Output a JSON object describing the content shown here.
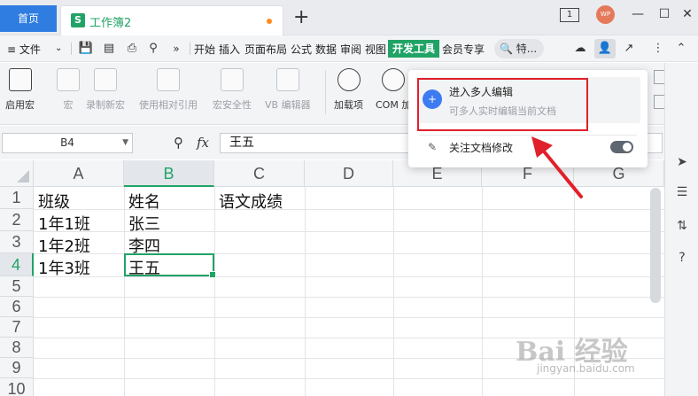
{
  "tabbar": {
    "home_label": "首页",
    "doc_icon": "S",
    "doc_title": "工作簿2",
    "add_label": "+",
    "page_icon_label": "1",
    "avatar_label": "WP"
  },
  "menubar": {
    "file_label": "≡ 文件",
    "items": [
      "开始",
      "插入",
      "页面布局",
      "公式",
      "数据",
      "审阅",
      "视图"
    ],
    "active_label": "开发工具",
    "member_label": "会员专享",
    "search_label": "查找",
    "search_short": "特..."
  },
  "ribbon": {
    "buttons": [
      {
        "label": "启用宏",
        "enabled": true
      },
      {
        "label": "宏",
        "enabled": false
      },
      {
        "label": "录制新宏",
        "enabled": false
      },
      {
        "label": "使用相对引用",
        "enabled": false
      },
      {
        "label": "宏安全性",
        "enabled": false
      },
      {
        "label": "VB 编辑器",
        "enabled": false
      },
      {
        "label": "加载项",
        "enabled": true
      },
      {
        "label": "COM 加",
        "enabled": true
      }
    ]
  },
  "formula": {
    "cell_ref": "B4",
    "fx_label": "fx",
    "content": "王五"
  },
  "sheet": {
    "columns": [
      "A",
      "B",
      "C",
      "D",
      "E",
      "F",
      "G"
    ],
    "rows": [
      "1",
      "2",
      "3",
      "4",
      "5",
      "6",
      "7",
      "8",
      "9",
      "10"
    ],
    "cells": {
      "A1": "班级",
      "B1": "姓名",
      "C1": "语文成绩",
      "A2": "1年1班",
      "B2": "张三",
      "A3": "1年2班",
      "B3": "李四",
      "A4": "1年3班",
      "B4": "王五"
    },
    "active_cell": "B4"
  },
  "popup": {
    "option1_title": "进入多人编辑",
    "option1_desc": "可多人实时编辑当前文档",
    "option2_label": "关注文档修改",
    "option2_toggle": "off"
  },
  "watermark": {
    "text": "Bai 经验",
    "sub": "jingyan.baidu.com"
  },
  "colors": {
    "accent": "#21a366",
    "highlight_rect": "#e0202a",
    "arrow": "#e0202a"
  }
}
